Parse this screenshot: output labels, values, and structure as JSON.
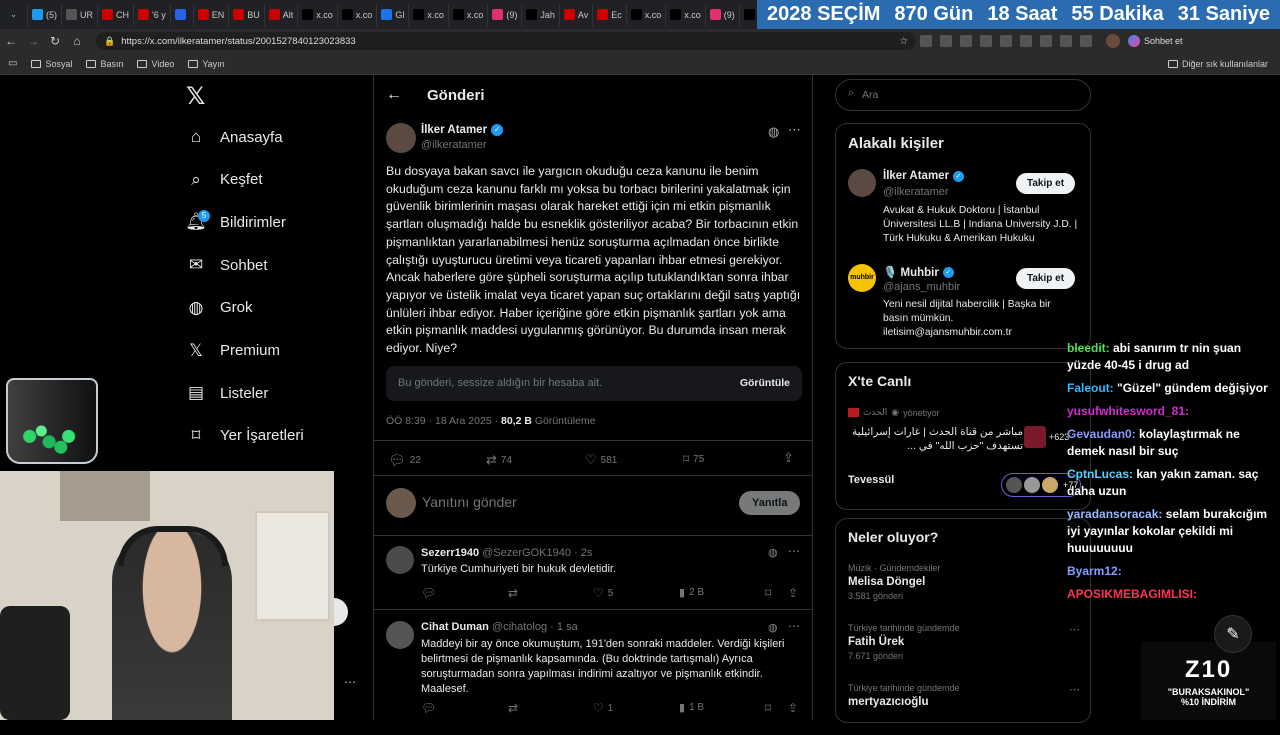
{
  "browser": {
    "tabs": [
      "(5)",
      "UR",
      "CH",
      "'6 y",
      "",
      "EN",
      "BU",
      "Alt",
      "x.co",
      "x.co",
      "Gl",
      "x.co",
      "x.co",
      "(9)",
      "Jah",
      "Av",
      "Ec",
      "x.co",
      "x.co",
      "(9)",
      "x.co",
      "(5)"
    ],
    "url": "https://x.com/ilkeratamer/status/2001527840123023833",
    "chat_button": "Sohbet et",
    "bookmarks": [
      "Sosyal",
      "Basın",
      "Video",
      "Yayın"
    ],
    "other_bookmarks": "Diğer sık kullanılanlar"
  },
  "countdown": {
    "election": "2028 SEÇİM",
    "days": "870 Gün",
    "hours": "18 Saat",
    "minutes": "55 Dakika",
    "seconds": "31 Saniye"
  },
  "sidebar": {
    "logo": "𝕏",
    "items": [
      {
        "label": "Anasayfa",
        "icon": "home-icon"
      },
      {
        "label": "Keşfet",
        "icon": "search-icon"
      },
      {
        "label": "Bildirimler",
        "icon": "bell-icon",
        "badge": "5"
      },
      {
        "label": "Sohbet",
        "icon": "mail-icon"
      },
      {
        "label": "Grok",
        "icon": "grok-icon"
      },
      {
        "label": "Premium",
        "icon": "x-icon"
      },
      {
        "label": "Listeler",
        "icon": "list-icon"
      },
      {
        "label": "Yer İşaretleri",
        "icon": "bookmark-icon"
      }
    ]
  },
  "post": {
    "header": "Gönderi",
    "author_name": "İlker Atamer",
    "author_handle": "@ilkeratamer",
    "text": "Bu dosyaya bakan savcı ile yargıcın okuduğu ceza kanunu ile benim okuduğum ceza kanunu farklı mı yoksa bu torbacı birilerini yakalatmak için güvenlik birimlerinin maşası olarak hareket ettiği için mi etkin pişmanlık şartları oluşmadığı halde bu esneklik gösteriliyor acaba? Bir torbacının etkin pişmanlıktan yararlanabilmesi henüz soruşturma açılmadan önce birlikte çalıştığı uyuşturucu üretimi veya ticareti yapanları ihbar etmesi gerekiyor. Ancak haberlere göre şüpheli soruşturma açılıp tutuklandıktan sonra ihbar yapıyor ve üstelik imalat veya ticaret yapan suç ortaklarını değil satış yaptığı ünlüleri ihbar ediyor. Haber içeriğine göre etkin pişmanlık şartları yok ama etkin pişmanlık maddesi uygulanmış görünüyor. Bu durumda insan merak ediyor. Niye?",
    "muted_notice": "Bu gönderi, sessize aldığın bir hesaba ait.",
    "view_button": "Görüntüle",
    "timestamp": "ÖÖ 8:39 · 18 Ara 2025 · ",
    "views": "80,2 B",
    "views_label": " Görüntüleme",
    "replies": "22",
    "reposts": "74",
    "likes": "581",
    "bookmarks": "75",
    "reply_placeholder": "Yanıtını gönder",
    "reply_button": "Yanıtla"
  },
  "replies": [
    {
      "name": "Sezerr1940",
      "handle": "@SezerGOK1940",
      "time": "· 2s",
      "text": "Türkiye Cumhuriyeti bir hukuk devletidir.",
      "likes": "5",
      "views": "2 B"
    },
    {
      "name": "Cihat Duman",
      "handle": "@cihatolog",
      "time": "· 1 sa",
      "text": "Maddeyi bir ay önce okumuştum, 191'den sonraki maddeler. Verdiği kişileri belirtmesi de pişmanlık kapsamında. (Bu doktrinde tartışmalı) Ayrıca soruşturmadan sonra yapılması indirimi azaltıyor ve pişmanlık etkindir. Maalesef.",
      "likes": "1",
      "views": "1 B"
    }
  ],
  "right": {
    "search_placeholder": "Ara",
    "related_title": "Alakalı kişiler",
    "people": [
      {
        "name": "İlker Atamer",
        "handle": "@ilkeratamer",
        "bio": "Avukat & Hukuk Doktoru | İstanbul Üniversitesi LL.B | Indiana University J.D. | Türk Hukuku & Amerikan Hukuku",
        "button": "Takip et"
      },
      {
        "name": "🎙️ Muhbir",
        "handle": "@ajans_muhbir",
        "bio": "Yeni nesil dijital habercilik | Başka bir basın mümkün. iletisim@ajansmuhbir.com.tr",
        "button": "Takip et",
        "logo_text": "muhbir"
      }
    ],
    "live_title": "X'te Canlı",
    "live": [
      {
        "host": "الحدث",
        "role": "yönetiyor",
        "text": "مباشر من قناة الحدث | غارات إسرائيلية تستهدف \"حزب الله\" في ...",
        "count": "+623"
      },
      {
        "host": "Tevessül",
        "count": "+77"
      }
    ],
    "trends_title": "Neler oluyor?",
    "trends": [
      {
        "meta": "Müzik · Gündemdekiler",
        "name": "Melisa Döngel",
        "count": "3.581 gönderi"
      },
      {
        "meta": "Türkiye tarihinde gündemde",
        "name": "Fatih Ürek",
        "count": "7.671 gönderi"
      },
      {
        "meta": "Türkiye tarihinde gündemde",
        "name": "mertyazıcıoğlu",
        "count": ""
      }
    ]
  },
  "chat": [
    {
      "user": "bleedit:",
      "msg": " abi sanırım tr nin şuan yüzde 40-45 i drug ad",
      "color": "#4fe04f"
    },
    {
      "user": "Faleout:",
      "msg": " \"Güzel\" gündem değişiyor",
      "color": "#38b6ff"
    },
    {
      "user": "yusufwhitesword_81:",
      "msg": "",
      "color": "#d12bd1"
    },
    {
      "user": "Gevaudan0:",
      "msg": " kolaylaştırmak ne demek nasıl bir suç",
      "color": "#8a9bff"
    },
    {
      "user": "CptnLucas:",
      "msg": " kan yakın zaman. saç daha uzun",
      "color": "#5ad1ff"
    },
    {
      "user": "yaradansoracak:",
      "msg": " selam burakcığım iyi yayınlar kokolar çekildi mi huuuuuuuu",
      "color": "#9ab8ff"
    },
    {
      "user": "Byarm12:",
      "msg": "",
      "color": "#8a9bff"
    },
    {
      "user": "APOSIKMEBAGIMLISI:",
      "msg": "",
      "color": "#ff3355"
    }
  ],
  "sponsor": {
    "logo": "Z10",
    "code": "\"BURAKSAKINOL\"",
    "discount": "%10 İNDİRİM"
  },
  "colors": {
    "accent": "#1d9bf0",
    "verified": "#1d9bf0",
    "countdown_bg": "#2b6cb0"
  }
}
